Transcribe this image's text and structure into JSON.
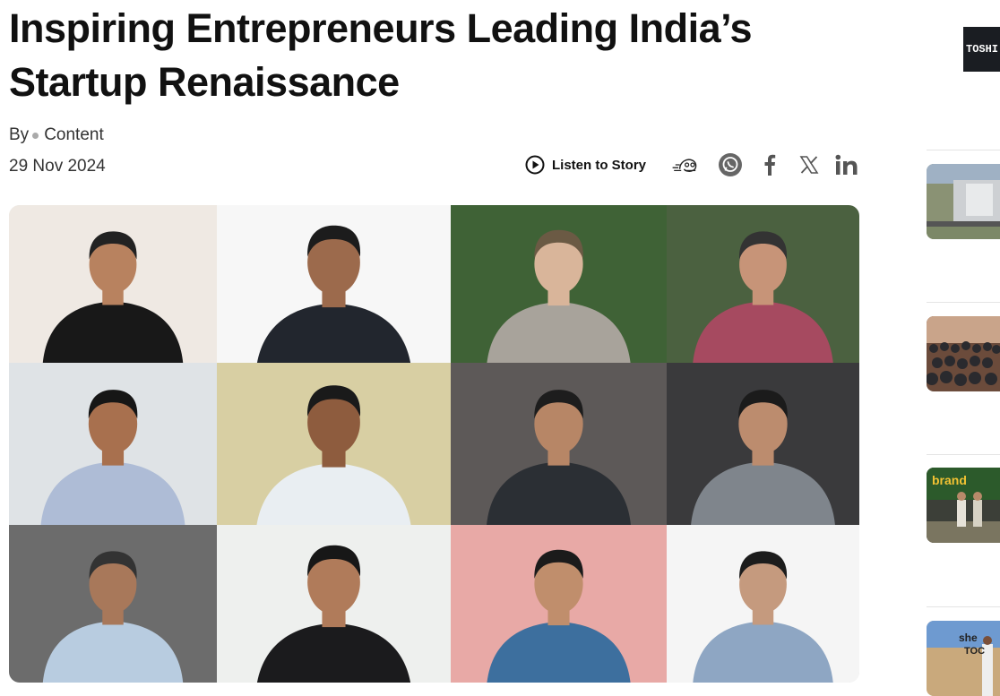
{
  "article": {
    "headline": "Inspiring Entrepreneurs Leading India’s Startup Renaissance",
    "by_label": "By",
    "author": "Content",
    "date": "29 Nov 2024"
  },
  "share": {
    "listen_label": "Listen to Story",
    "icons": [
      "play-circle-icon",
      "share-hands-icon",
      "whatsapp-icon",
      "facebook-icon",
      "x-icon",
      "linkedin-icon"
    ]
  },
  "hero_image": {
    "layout": "collage 3 rows x 4 columns of entrepreneur portraits",
    "tiles": [
      {
        "bg": "#efe9e3",
        "shirt": "#181818",
        "skin": "#b8825f",
        "hair": "#222"
      },
      {
        "bg": "#f7f7f7",
        "shirt": "#22262e",
        "skin": "#9c6a4c",
        "hair": "#1c1c1c"
      },
      {
        "bg": "#3f6236",
        "shirt": "#a8a39b",
        "skin": "#d9b59a",
        "hair": "#6b5a44"
      },
      {
        "bg": "#4b6140",
        "shirt": "#a64a60",
        "skin": "#c79478",
        "hair": "#333"
      },
      {
        "bg": "#dfe3e6",
        "shirt": "#aebcd6",
        "skin": "#a8704e",
        "hair": "#161616"
      },
      {
        "bg": "#d8cfa3",
        "shirt": "#e9eef2",
        "skin": "#8e5c3e",
        "hair": "#1a1a1a"
      },
      {
        "bg": "#5d5958",
        "shirt": "#2b2f34",
        "skin": "#b78666",
        "hair": "#1d1d1d"
      },
      {
        "bg": "#3a3a3c",
        "shirt": "#7f858c",
        "skin": "#bc8c6e",
        "hair": "#1b1b1b"
      },
      {
        "bg": "#6c6c6c",
        "shirt": "#b8cce0",
        "skin": "#a8785a",
        "hair": "#333"
      },
      {
        "bg": "#eef0ee",
        "shirt": "#1b1b1d",
        "skin": "#b07b5a",
        "hair": "#171717"
      },
      {
        "bg": "#e8a9a6",
        "shirt": "#3d6f9e",
        "skin": "#c08e6c",
        "hair": "#1b1b1b"
      },
      {
        "bg": "#f5f5f5",
        "shirt": "#8ea6c3",
        "skin": "#c59a7e",
        "hair": "#1c1c1c"
      }
    ]
  },
  "sidebar": {
    "ad_text": "TOSHI",
    "stories": [
      {
        "thumb": "aerial-factory"
      },
      {
        "thumb": "crowd-group"
      },
      {
        "thumb": "brand-event",
        "label": "brand"
      },
      {
        "thumb": "she-event",
        "label": "she",
        "sublabel": "TOC"
      }
    ]
  }
}
